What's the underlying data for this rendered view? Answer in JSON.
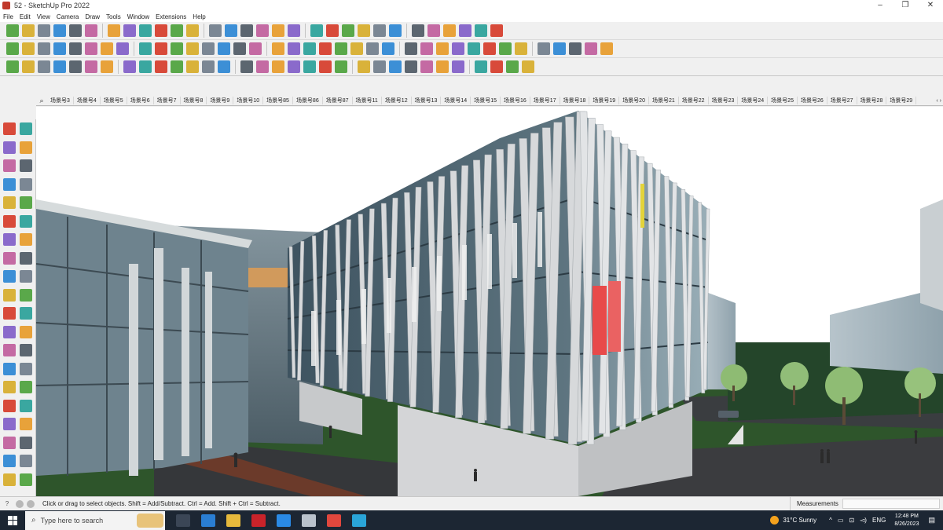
{
  "window": {
    "title": "52 - SketchUp Pro 2022",
    "minimize": "–",
    "maximize": "❐",
    "close": "✕"
  },
  "menu": [
    "File",
    "Edit",
    "View",
    "Camera",
    "Draw",
    "Tools",
    "Window",
    "Extensions",
    "Help"
  ],
  "scenes": {
    "tabs": [
      "场景号3",
      "场景号4",
      "场景号5",
      "场景号6",
      "场景号7",
      "场景号8",
      "场景号9",
      "场景号10",
      "场景号85",
      "场景号86",
      "场景号87",
      "场景号11",
      "场景号12",
      "场景号13",
      "场景号14",
      "场景号15",
      "场景号16",
      "场景号17",
      "场景号18",
      "场景号19",
      "场景号20",
      "场景号21",
      "场景号22",
      "场景号23",
      "场景号24",
      "场景号25",
      "场景号26",
      "场景号27",
      "场景号28",
      "场景号29"
    ],
    "search_glyph": "⌕",
    "scroll_glyph": "‹ ›"
  },
  "status": {
    "help_glyph": "?",
    "message": "Click or drag to select objects. Shift = Add/Subtract. Ctrl = Add. Shift + Ctrl = Subtract.",
    "measurements_label": "Measurements"
  },
  "taskbar": {
    "search_glyph": "⌕",
    "search_placeholder": "Type here to search",
    "weather": "31°C  Sunny",
    "tray_arrow": "^",
    "tray_icons": [
      "▭",
      "⊡",
      "◅)"
    ],
    "language": "ENG",
    "time": "12:48 PM",
    "date": "8/26/2023",
    "notifications_glyph": "▤"
  },
  "colors": {
    "accent_blue": "#1f73c2",
    "selection_red": "#e94141",
    "glass": "#5e7380",
    "fins": "#d5d7d9",
    "grass": "#2f5a2c",
    "sky": "#ffffff"
  },
  "icons": {
    "toolbar1": [
      "zoom-window-icon",
      "select-arrow-icon",
      "eraser-icon",
      "pencil-line-icon",
      "arc-icon",
      "paint-bucket-icon",
      "push-pull-icon",
      "follow-me-icon",
      "move-icon",
      "rotate-icon",
      "tape-measure-icon",
      "text-icon",
      "3d-text-icon",
      "orbit-icon",
      "pan-icon",
      "zoom-icon",
      "zoom-extents-icon",
      "section-plane-icon",
      "section-display-icon",
      "section-cut-icon",
      "match-photo-icon",
      "position-camera-icon",
      "look-around-icon",
      "walk-icon",
      "sandbox-smoove-icon",
      "sandbox-stamp-icon",
      "sandbox-drape-icon",
      "undo-icon",
      "redo-icon",
      "share-icon"
    ],
    "toolbar2": [
      "iso-view-icon",
      "top-view-icon",
      "front-view-icon",
      "right-view-icon",
      "back-view-icon",
      "left-view-icon",
      "bottom-view-icon",
      "xray-icon",
      "wireframe-icon",
      "hidden-line-icon",
      "shaded-icon",
      "textured-icon",
      "monochrome-icon",
      "3d-warehouse-icon",
      "component-icon",
      "group-icon",
      "layer-icon",
      "shadow-icon",
      "fog-icon",
      "edge-style-icon",
      "outline-icon",
      "lattice-icon",
      "offset-icon",
      "polygon-icon",
      "ellipse-icon",
      "curve-icon",
      "fillet-icon",
      "chamfer-icon",
      "extrude-icon",
      "loft-icon",
      "sweep-icon",
      "weld-icon",
      "array-icon",
      "grid-icon",
      "material-icon",
      "texture-icon",
      "paint-icon"
    ],
    "toolbar3": [
      "line-tool-icon",
      "freehand-icon",
      "bezier-icon",
      "split-icon",
      "subdivide-icon",
      "smooth-icon",
      "cleanup-icon",
      "intersect-icon",
      "union-icon",
      "subtract-icon",
      "trim-icon",
      "split-solid-icon",
      "shell-icon",
      "flip-icon",
      "mirror-icon",
      "scale-icon",
      "rotate-3d-icon",
      "align-icon",
      "distribute-icon",
      "stairs-icon",
      "roof-icon",
      "wall-icon",
      "window-tool-icon",
      "door-icon",
      "column-icon",
      "beam-icon",
      "slab-icon",
      "railing-icon",
      "terrain-icon",
      "tree-icon",
      "figure-icon",
      "render-icon"
    ],
    "lefttool": [
      "select-icon",
      "orbit-icon",
      "paint-bucket-icon",
      "eraser-icon",
      "component-icon",
      "tag-icon",
      "line-icon",
      "freehand-icon",
      "rectangle-icon",
      "rotated-rect-icon",
      "circle-icon",
      "polygon-icon",
      "arc-icon",
      "two-point-arc-icon",
      "pie-icon",
      "three-point-arc-icon",
      "move-icon",
      "push-pull-icon",
      "rotate-icon",
      "follow-me-icon",
      "scale-icon",
      "offset-icon",
      "tape-measure-icon",
      "dimension-icon",
      "protractor-icon",
      "text-icon",
      "axes-icon",
      "3d-text-icon",
      "orbit-view-icon",
      "pan-view-icon",
      "zoom-view-icon",
      "zoom-window-icon",
      "zoom-extents-icon",
      "previous-view-icon",
      "position-camera-icon",
      "look-around-icon",
      "walk-icon",
      "section-plane-icon",
      "section-icon",
      "sandbox-icon"
    ]
  }
}
